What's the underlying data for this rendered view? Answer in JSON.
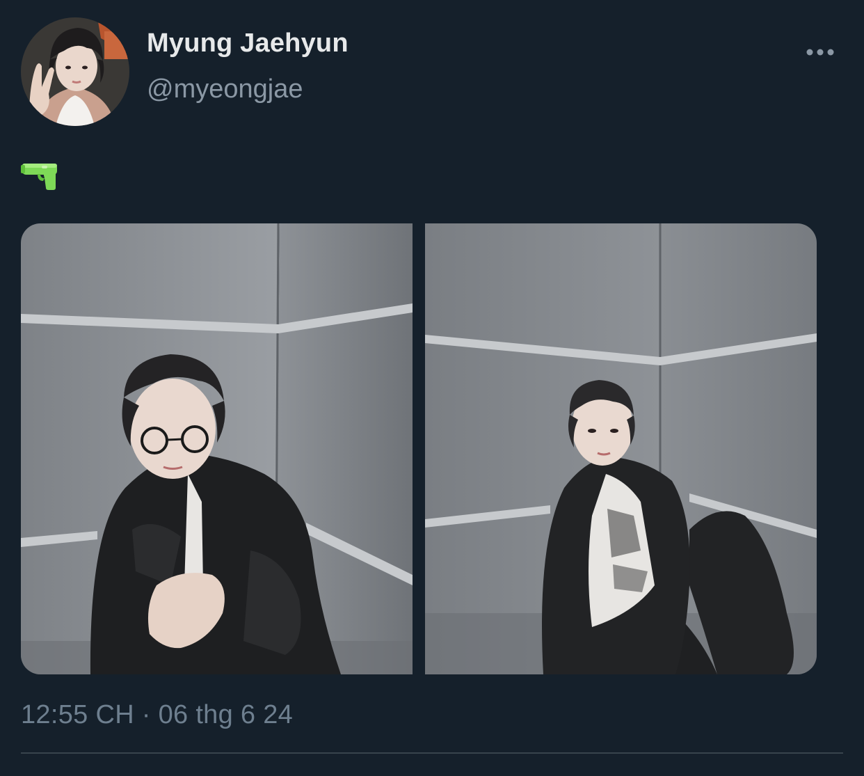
{
  "tweet": {
    "author": {
      "display_name": "Myung Jaehyun",
      "handle": "@myeongjae",
      "avatar_icon": "profile-photo"
    },
    "menu_icon": "more-dots-icon",
    "text_emoji": "water-pistol-emoji",
    "media": [
      {
        "icon": "photo-person-glasses-sitting-in-corner"
      },
      {
        "icon": "photo-person-leaning-in-corner"
      }
    ],
    "timestamp": "12:55 CH · 06 thg 6 24"
  },
  "colors": {
    "background": "#15202b",
    "name": "#e7e9ea",
    "handle": "#8b98a5",
    "timestamp": "#6e7f8f",
    "divider": "#38444d",
    "emoji_green": "#7ed957"
  }
}
